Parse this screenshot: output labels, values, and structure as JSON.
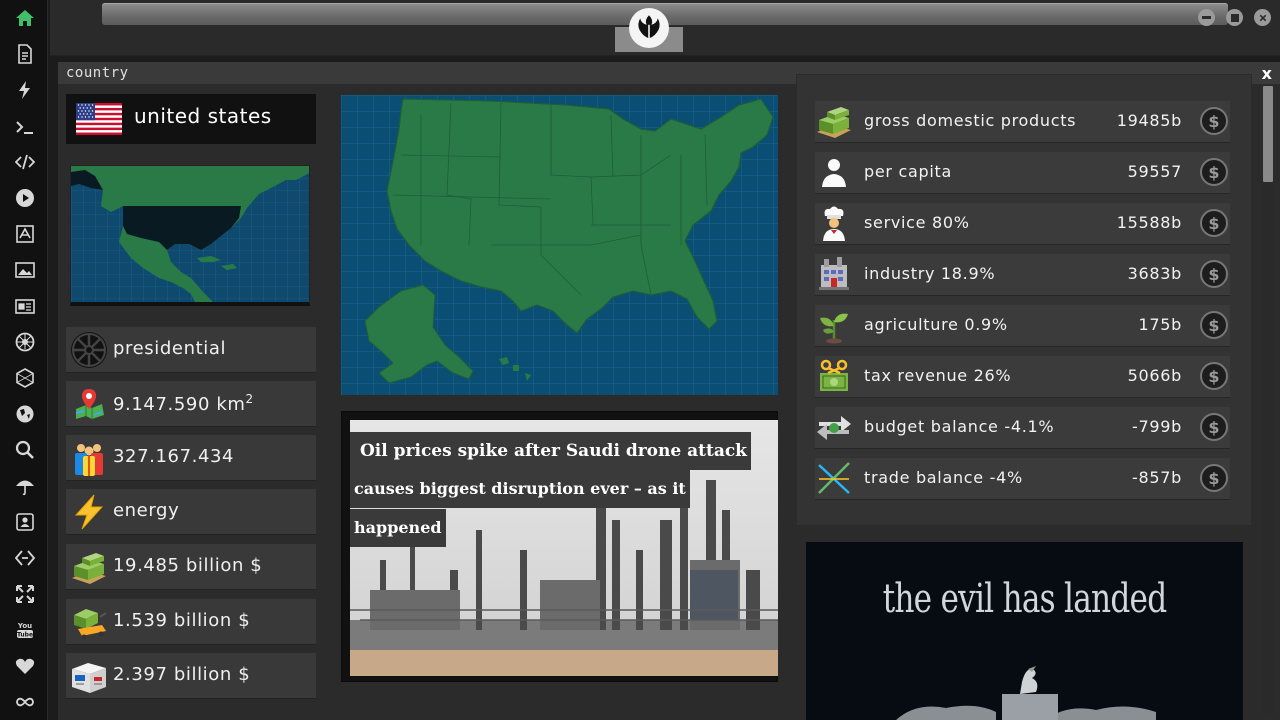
{
  "window": {
    "title": "country",
    "close_label": "x"
  },
  "country": {
    "name": "united states",
    "flag_icon": "us-flag-icon"
  },
  "left_stats": [
    {
      "icon": "galactic-empire-icon",
      "value": "presidential"
    },
    {
      "icon": "map-pin-icon",
      "value": "9.147.590 km",
      "sup": "2"
    },
    {
      "icon": "population-icon",
      "value": "327.167.434"
    },
    {
      "icon": "energy-bolt-icon",
      "value": "energy"
    },
    {
      "icon": "money-stack-icon",
      "value": "19.485 billion $"
    },
    {
      "icon": "money-cart-icon",
      "value": "1.539 billion $"
    },
    {
      "icon": "shipping-box-icon",
      "value": "2.397 billion $"
    }
  ],
  "news": {
    "headline_lines": [
      "Oil prices spike after Saudi drone attack",
      "causes biggest disruption ever – as it",
      "happened"
    ]
  },
  "economy": [
    {
      "icon": "money-stack-icon",
      "label": "gross domestic products",
      "value": "19485b"
    },
    {
      "icon": "person-icon",
      "label": "per capita",
      "value": "59557"
    },
    {
      "icon": "chef-icon",
      "label": "service 80%",
      "value": "15588b"
    },
    {
      "icon": "factory-icon",
      "label": "industry 18.9%",
      "value": "3683b"
    },
    {
      "icon": "plant-icon",
      "label": "agriculture 0.9%",
      "value": "175b"
    },
    {
      "icon": "tax-money-icon",
      "label": "tax revenue 26%",
      "value": "5066b"
    },
    {
      "icon": "transfer-arrows-icon",
      "label": "budget balance -4.1%",
      "value": "-799b"
    },
    {
      "icon": "trade-cross-icon",
      "label": "trade balance -4%",
      "value": "-857b"
    }
  ],
  "coin_symbol": "$",
  "poster": {
    "title": "the evil has landed"
  },
  "colors": {
    "map_land": "#2a7a48",
    "map_sea": "#0b4e74",
    "panel_bg": "#2b2b2b",
    "row_bg": "#393939"
  }
}
